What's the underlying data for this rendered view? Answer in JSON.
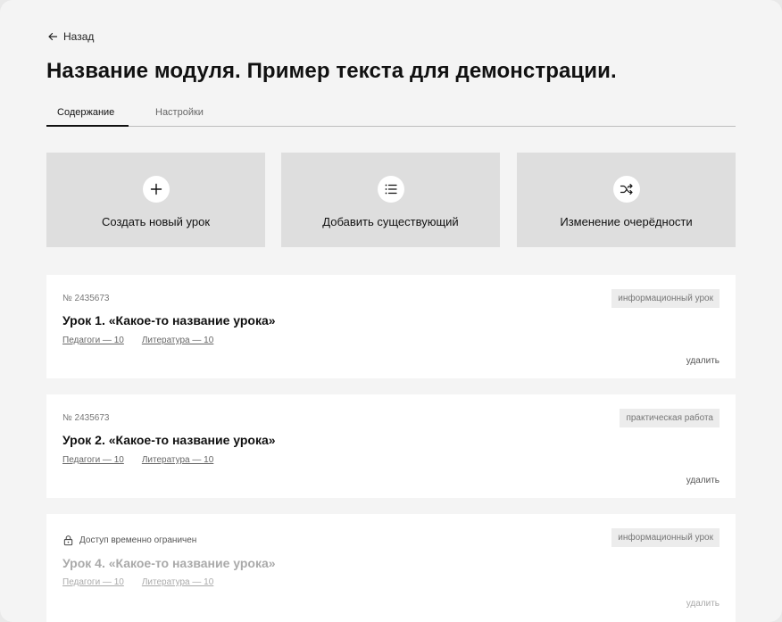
{
  "nav": {
    "back_label": "Назад"
  },
  "page": {
    "title": "Название модуля. Пример текста для демонстрации."
  },
  "tabs": [
    {
      "label": "Содержание",
      "active": true
    },
    {
      "label": "Настройки",
      "active": false
    }
  ],
  "actions": [
    {
      "label": "Создать новый урок",
      "icon": "plus-icon"
    },
    {
      "label": "Добавить существующий",
      "icon": "list-icon"
    },
    {
      "label": "Изменение очерёдности",
      "icon": "shuffle-icon"
    }
  ],
  "lessons": [
    {
      "number": "№ 2435673",
      "title": "Урок 1. «Какое-то название урока»",
      "link1": "Педагоги — 10",
      "link2": "Литература — 10",
      "badge": "информационный урок",
      "delete_label": "удалить"
    },
    {
      "number": "№ 2435673",
      "title": "Урок 2. «Какое-то название урока»",
      "link1": "Педагоги — 10",
      "link2": "Литература — 10",
      "badge": "практическая работа",
      "delete_label": "удалить"
    },
    {
      "restricted_label": "Доступ временно ограничен",
      "restricted_icon": "lock-icon",
      "title": "Урок 4. «Какое-то название урока»",
      "link1": "Педагоги — 10",
      "link2": "Литература — 10",
      "badge": "информационный урок",
      "delete_label": "удалить"
    }
  ],
  "colors": {
    "background": "#f4f4f4",
    "card": "#ffffff",
    "action_card": "#dedede",
    "badge_bg": "#ececec",
    "text": "#111111",
    "muted": "#777777",
    "disabled": "#aaaaaa"
  }
}
